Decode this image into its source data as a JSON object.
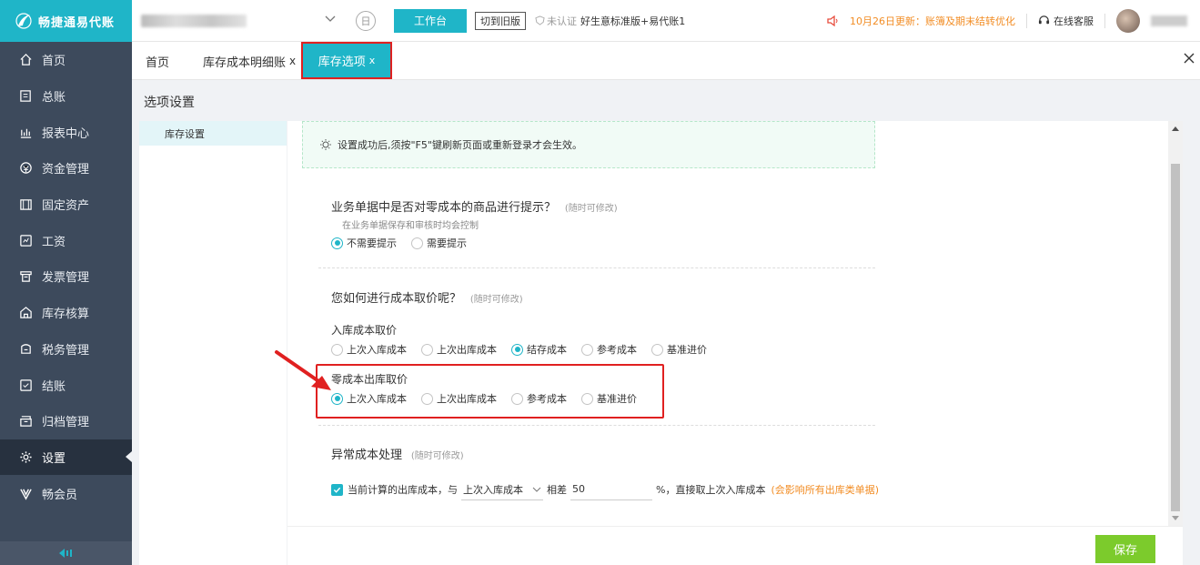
{
  "app": {
    "logo_text": "畅捷通易代账"
  },
  "sidebar": {
    "items": [
      {
        "label": "首页",
        "icon": "home-icon"
      },
      {
        "label": "总账",
        "icon": "ledger-icon"
      },
      {
        "label": "报表中心",
        "icon": "chart-icon"
      },
      {
        "label": "资金管理",
        "icon": "fund-icon"
      },
      {
        "label": "固定资产",
        "icon": "asset-icon"
      },
      {
        "label": "工资",
        "icon": "salary-icon"
      },
      {
        "label": "发票管理",
        "icon": "invoice-icon"
      },
      {
        "label": "库存核算",
        "icon": "inventory-icon"
      },
      {
        "label": "税务管理",
        "icon": "tax-icon"
      },
      {
        "label": "结账",
        "icon": "close-books-icon"
      },
      {
        "label": "归档管理",
        "icon": "archive-icon"
      },
      {
        "label": "设置",
        "icon": "gear-icon"
      },
      {
        "label": "畅会员",
        "icon": "vip-icon"
      }
    ],
    "active_index": 11
  },
  "topbar": {
    "date_icon_glyph": "日",
    "workbench_label": "工作台",
    "old_version_label": "切到旧版",
    "cert_label": "未认证",
    "edition_label": "好生意标准版+易代账1",
    "notice_text": "10月26日更新：账簿及期末结转优化",
    "service_label": "在线客服"
  },
  "tabs": {
    "home": "首页",
    "ledger": "库存成本明细账",
    "active": "库存选项",
    "close_glyph": "x"
  },
  "page": {
    "title": "选项设置",
    "left_menu": [
      "库存设置"
    ]
  },
  "settings": {
    "tip": "设置成功后,须按\"F5\"键刷新页面或重新登录才会生效。",
    "zero_cost_prompt": {
      "title": "业务单据中是否对零成本的商品进行提示？",
      "note": "(随时可修改)",
      "sub": "在业务单据保存和审核时均会控制",
      "options": [
        "不需要提示",
        "需要提示"
      ],
      "selected": 0
    },
    "cost_method": {
      "title": "您如何进行成本取价呢？",
      "note": "(随时可修改)",
      "inbound_label": "入库成本取价",
      "inbound_options": [
        "上次入库成本",
        "上次出库成本",
        "结存成本",
        "参考成本",
        "基准进价"
      ],
      "inbound_selected": 2,
      "zero_out_label": "零成本出库取价",
      "zero_out_options": [
        "上次入库成本",
        "上次出库成本",
        "参考成本",
        "基准进价"
      ],
      "zero_out_selected": 0
    },
    "abnormal": {
      "title": "异常成本处理",
      "note": "(随时可修改)",
      "checked": true,
      "text1": "当前计算的出库成本，与",
      "select_value": "上次入库成本",
      "text2": "相差",
      "percent_value": "50",
      "text3": "%，直接取上次入库成本",
      "warn": "(会影响所有出库类单据)"
    }
  },
  "footer": {
    "save_label": "保存"
  },
  "colors": {
    "brand": "#1fb5c8",
    "sidebar": "#3d4a5c",
    "save": "#7ccb2c",
    "highlight": "#e02020",
    "notice": "#f28d25"
  }
}
